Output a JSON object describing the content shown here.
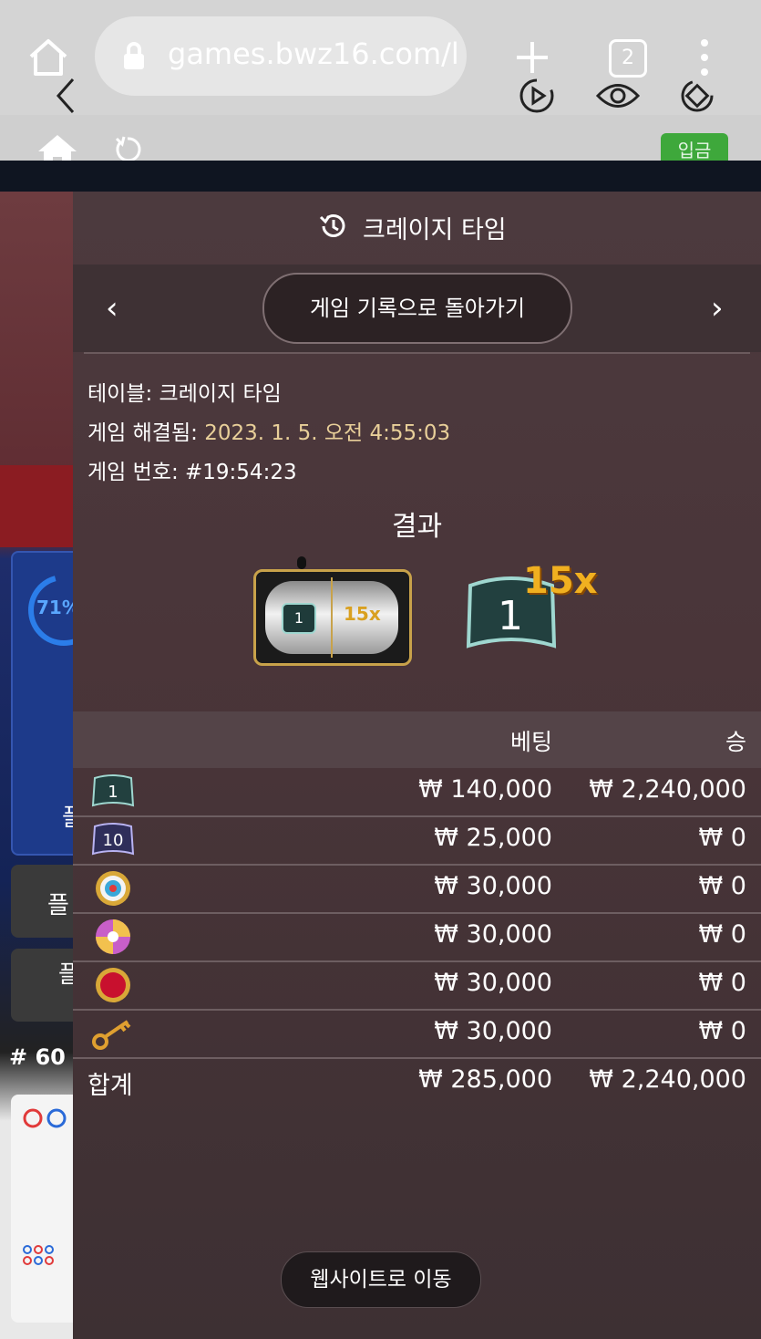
{
  "browser": {
    "url": "games.bwz16.com/l",
    "tab_count": "2"
  },
  "site": {
    "deposit_label": "입금"
  },
  "background": {
    "percent": "71%",
    "round_number": "# 60",
    "button_char": "플"
  },
  "modal": {
    "title": "크레이지 타임",
    "back_to_history": "게임 기록으로 돌아가기",
    "table_label": "테이블:",
    "table_value": "크레이지 타임",
    "resolved_label": "게임 해결됨:",
    "resolved_value": "2023. 1. 5. 오전 4:55:03",
    "game_no_label": "게임 번호:",
    "game_no_value": "#19:54:23",
    "result_heading": "결과",
    "slot": {
      "segment": "1",
      "multiplier": "15x"
    },
    "result": {
      "segment": "1",
      "multiplier": "15x"
    },
    "columns": {
      "bet": "베팅",
      "win": "승"
    },
    "rows": [
      {
        "icon": "segment-1-icon",
        "label": "1",
        "bet": "₩ 140,000",
        "win": "₩ 2,240,000"
      },
      {
        "icon": "segment-10-icon",
        "label": "10",
        "bet": "₩ 25,000",
        "win": "₩ 0"
      },
      {
        "icon": "cash-hunt-icon",
        "label": "",
        "bet": "₩ 30,000",
        "win": "₩ 0"
      },
      {
        "icon": "pachinko-icon",
        "label": "",
        "bet": "₩ 30,000",
        "win": "₩ 0"
      },
      {
        "icon": "coin-flip-icon",
        "label": "",
        "bet": "₩ 30,000",
        "win": "₩ 0"
      },
      {
        "icon": "crazy-time-key-icon",
        "label": "",
        "bet": "₩ 30,000",
        "win": "₩ 0"
      }
    ],
    "total_label": "합계",
    "total_bet": "₩ 285,000",
    "total_win": "₩ 2,240,000",
    "go_to_site": "웹사이트로 이동"
  },
  "colors": {
    "accent_gold": "#e8cf99",
    "deposit_green": "#3ea83b",
    "modal_bg": "#4a3539"
  }
}
